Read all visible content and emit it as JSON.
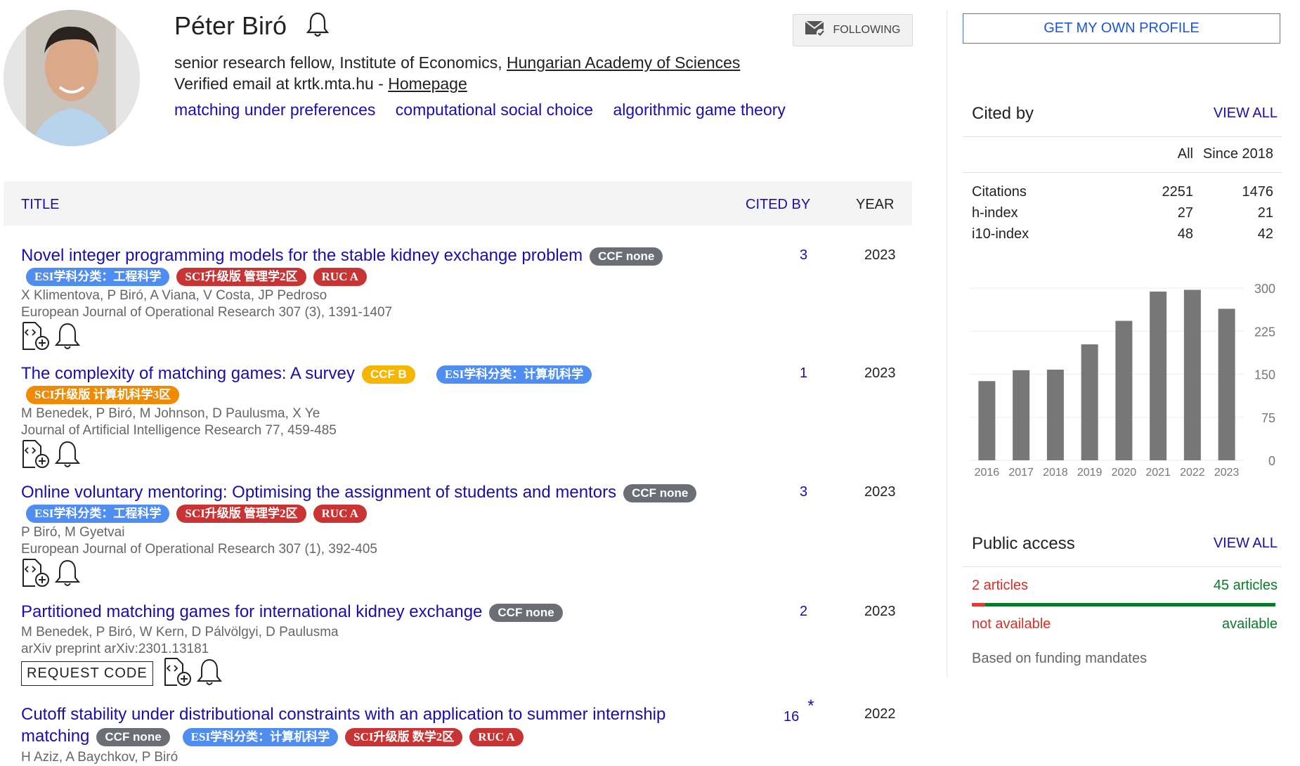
{
  "profile": {
    "name": "Péter Biró",
    "follow_label": "FOLLOWING",
    "affiliation_prefix": "senior research fellow, Institute of Economics, ",
    "affiliation_link": "Hungarian Academy of Sciences",
    "email_prefix": "Verified email at krtk.mta.hu - ",
    "homepage": "Homepage",
    "interests": [
      "matching under preferences",
      "computational social choice",
      "algorithmic game theory"
    ]
  },
  "table": {
    "title_header": "TITLE",
    "cited_header": "CITED BY",
    "year_header": "YEAR"
  },
  "articles": [
    {
      "title": "Novel integer programming models for the stable kidney exchange problem",
      "inline_badges": [
        {
          "text": "CCF none",
          "color": "gray"
        }
      ],
      "badges": [
        {
          "text": "ESI学科分类：工程科学",
          "color": "blue"
        },
        {
          "text": "SCI升级版 管理学2区",
          "color": "red"
        },
        {
          "text": "RUC A",
          "color": "red"
        }
      ],
      "authors": "X Klimentova, P Biró, A Viana, V Costa, JP Pedroso",
      "venue": "European Journal of Operational Research 307 (3), 1391-1407",
      "cited": "3",
      "year": "2023"
    },
    {
      "title": "The complexity of matching games: A survey",
      "inline_badges": [
        {
          "text": "CCF B",
          "color": "yellow"
        },
        {
          "text": "ESI学科分类：计算机科学",
          "color": "blue"
        }
      ],
      "badges": [
        {
          "text": "SCI升级版 计算机科学3区",
          "color": "orange"
        }
      ],
      "authors": "M Benedek, P Biró, M Johnson, D Paulusma, X Ye",
      "venue": "Journal of Artificial Intelligence Research 77, 459-485",
      "cited": "1",
      "year": "2023"
    },
    {
      "title": "Online voluntary mentoring: Optimising the assignment of students and mentors",
      "inline_badges": [
        {
          "text": "CCF none",
          "color": "gray"
        }
      ],
      "badges": [
        {
          "text": "ESI学科分类：工程科学",
          "color": "blue"
        },
        {
          "text": "SCI升级版 管理学2区",
          "color": "red"
        },
        {
          "text": "RUC A",
          "color": "red"
        }
      ],
      "authors": "P Biró, M Gyetvai",
      "venue": "European Journal of Operational Research 307 (1), 392-405",
      "cited": "3",
      "year": "2023"
    },
    {
      "title": "Partitioned matching games for international kidney exchange",
      "inline_badges": [
        {
          "text": "CCF none",
          "color": "gray"
        }
      ],
      "badges": [],
      "authors": "M Benedek, P Biró, W Kern, D Pálvölgyi, D Paulusma",
      "venue": "arXiv preprint arXiv:2301.13181",
      "request_code": "REQUEST CODE",
      "cited": "2",
      "year": "2023"
    },
    {
      "title_line1": "Cutoff stability under distributional constraints with an application to summer internship",
      "title_line2": "matching",
      "inline_badges": [
        {
          "text": "CCF none",
          "color": "gray"
        },
        {
          "text": "ESI学科分类：计算机科学",
          "color": "blue"
        },
        {
          "text": "SCI升级版 数学2区",
          "color": "red"
        },
        {
          "text": "RUC A",
          "color": "red"
        }
      ],
      "authors": "H Aziz, A Baychkov, P Biró",
      "cited": "16",
      "cited_mark": "*",
      "year": "2022"
    }
  ],
  "sidebar": {
    "own_profile": "GET MY OWN PROFILE",
    "cited_by": "Cited by",
    "view_all": "VIEW ALL",
    "col_all": "All",
    "col_since": "Since 2018",
    "stats": [
      {
        "label": "Citations",
        "all": "2251",
        "since": "1476"
      },
      {
        "label": "h-index",
        "all": "27",
        "since": "21"
      },
      {
        "label": "i10-index",
        "all": "48",
        "since": "42"
      }
    ],
    "public_access": "Public access",
    "pa_view_all": "VIEW ALL",
    "not_avail_count": "2 articles",
    "avail_count": "45 articles",
    "not_avail": "not available",
    "avail": "available",
    "available_fraction": 0.957,
    "funding": "Based on funding mandates"
  },
  "chart_data": {
    "type": "bar",
    "categories": [
      "2016",
      "2017",
      "2018",
      "2019",
      "2020",
      "2021",
      "2022",
      "2023"
    ],
    "values": [
      138,
      157,
      158,
      202,
      243,
      294,
      297,
      264
    ],
    "y_ticks": [
      "0",
      "75",
      "150",
      "225",
      "300"
    ],
    "ylim": [
      0,
      300
    ],
    "color": "#777777"
  }
}
